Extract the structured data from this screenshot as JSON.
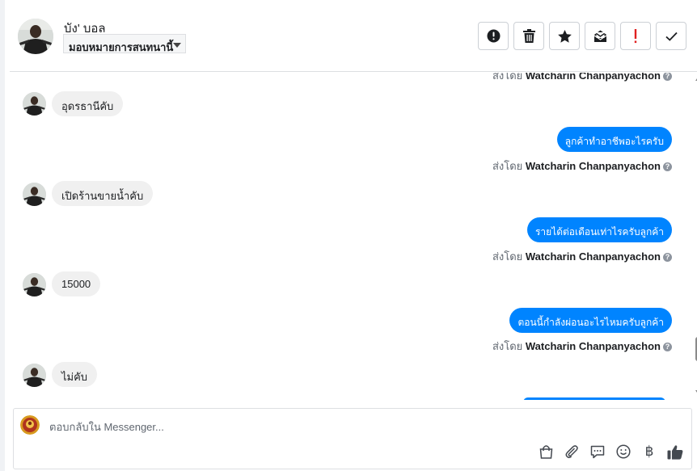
{
  "header": {
    "contact_name": "บัง' บอล",
    "assign_label": "มอบหมายการสนทนานี้",
    "toolbar": [
      {
        "name": "mark-spam-button",
        "icon": "alert-circle-icon"
      },
      {
        "name": "delete-button",
        "icon": "trash-icon"
      },
      {
        "name": "star-button",
        "icon": "star-icon"
      },
      {
        "name": "mark-unread-button",
        "icon": "envelope-open-icon"
      },
      {
        "name": "follow-up-button",
        "icon": "exclamation-icon"
      },
      {
        "name": "mark-done-button",
        "icon": "checkmark-icon"
      }
    ]
  },
  "messages": {
    "sent_by_prefix": "ส่งโดย",
    "sent_by_name": "Watcharin Chanpanyachon",
    "help_mark": "?",
    "incoming": [
      "อุดรธานีคับ",
      "เปิดร้านขายน้ำคับ",
      "15000",
      "ไม่คับ"
    ],
    "outgoing": [
      "ลูกค้าทำอาชีพอะไรครับ",
      "รายได้ต่อเดือนเท่าไรครับลูกค้า",
      "ตอนนี้กำลังผ่อนอะไรไหมครับลูกค้า"
    ]
  },
  "composer": {
    "placeholder": "ตอบกลับใน Messenger...",
    "icons": [
      "shopping-bag-icon",
      "paperclip-icon",
      "saved-replies-icon",
      "emoji-icon",
      "baht-icon",
      "like-icon"
    ],
    "baht_glyph": "฿"
  },
  "colors": {
    "outgoing_bubble": "#0084ff",
    "incoming_bubble": "#f0f0f0",
    "follow_up_icon": "#e02020"
  }
}
